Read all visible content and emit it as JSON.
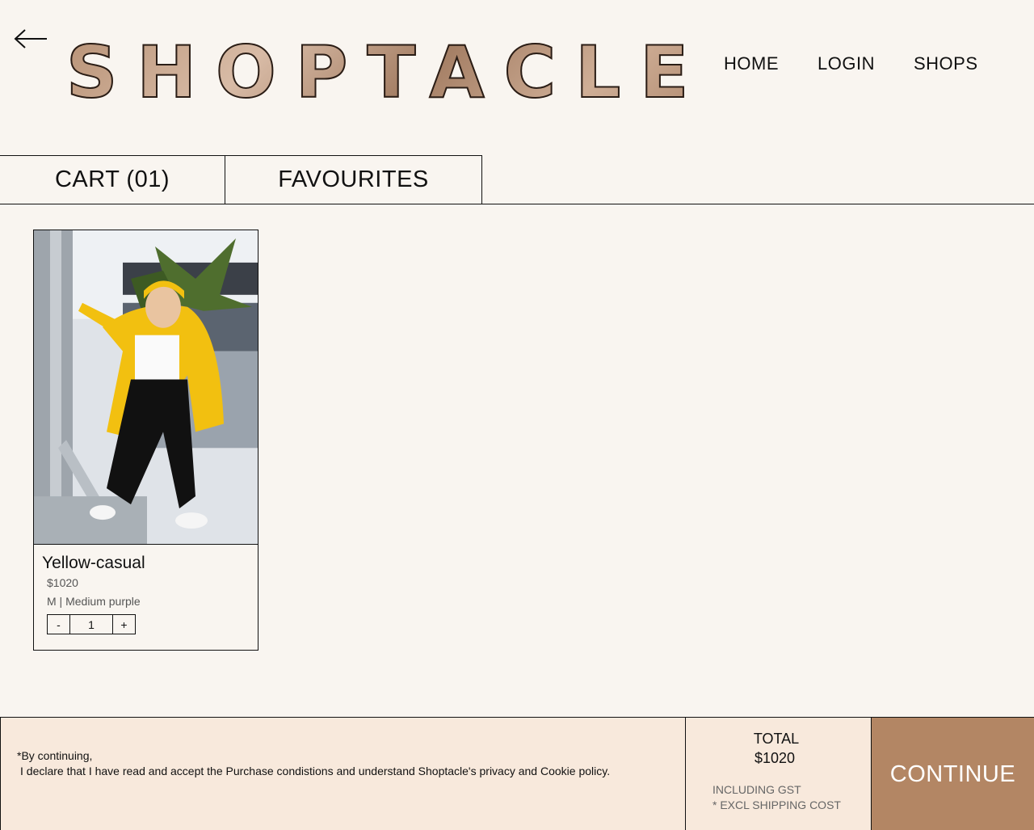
{
  "header": {
    "logo_text": "SHOPTACLE",
    "nav": {
      "home": "HOME",
      "login": "LOGIN",
      "shops": "SHOPS"
    }
  },
  "tabs": {
    "cart": "CART (01)",
    "favourites": "FAVOURITES"
  },
  "cart_item": {
    "title": "Yellow-casual",
    "price": "$1020",
    "variant": "M | Medium purple",
    "quantity": "1",
    "decrement": "-",
    "increment": "+"
  },
  "footer": {
    "disclaimer_line1": "*By continuing,",
    "disclaimer_line2": "I declare that I have read and accept the Purchase condistions and understand Shoptacle's privacy and Cookie policy.",
    "total_label": "TOTAL",
    "total_value": "$1020",
    "gst_note": "INCLUDING GST",
    "shipping_note": "* EXCL SHIPPING COST",
    "continue_label": "CONTINUE"
  },
  "colors": {
    "background": "#f9f5f0",
    "footer_background": "#f8e9dc",
    "accent": "#b38664",
    "logo_fill": "#c4a08a"
  },
  "icons": {
    "back": "arrow-left-icon"
  }
}
